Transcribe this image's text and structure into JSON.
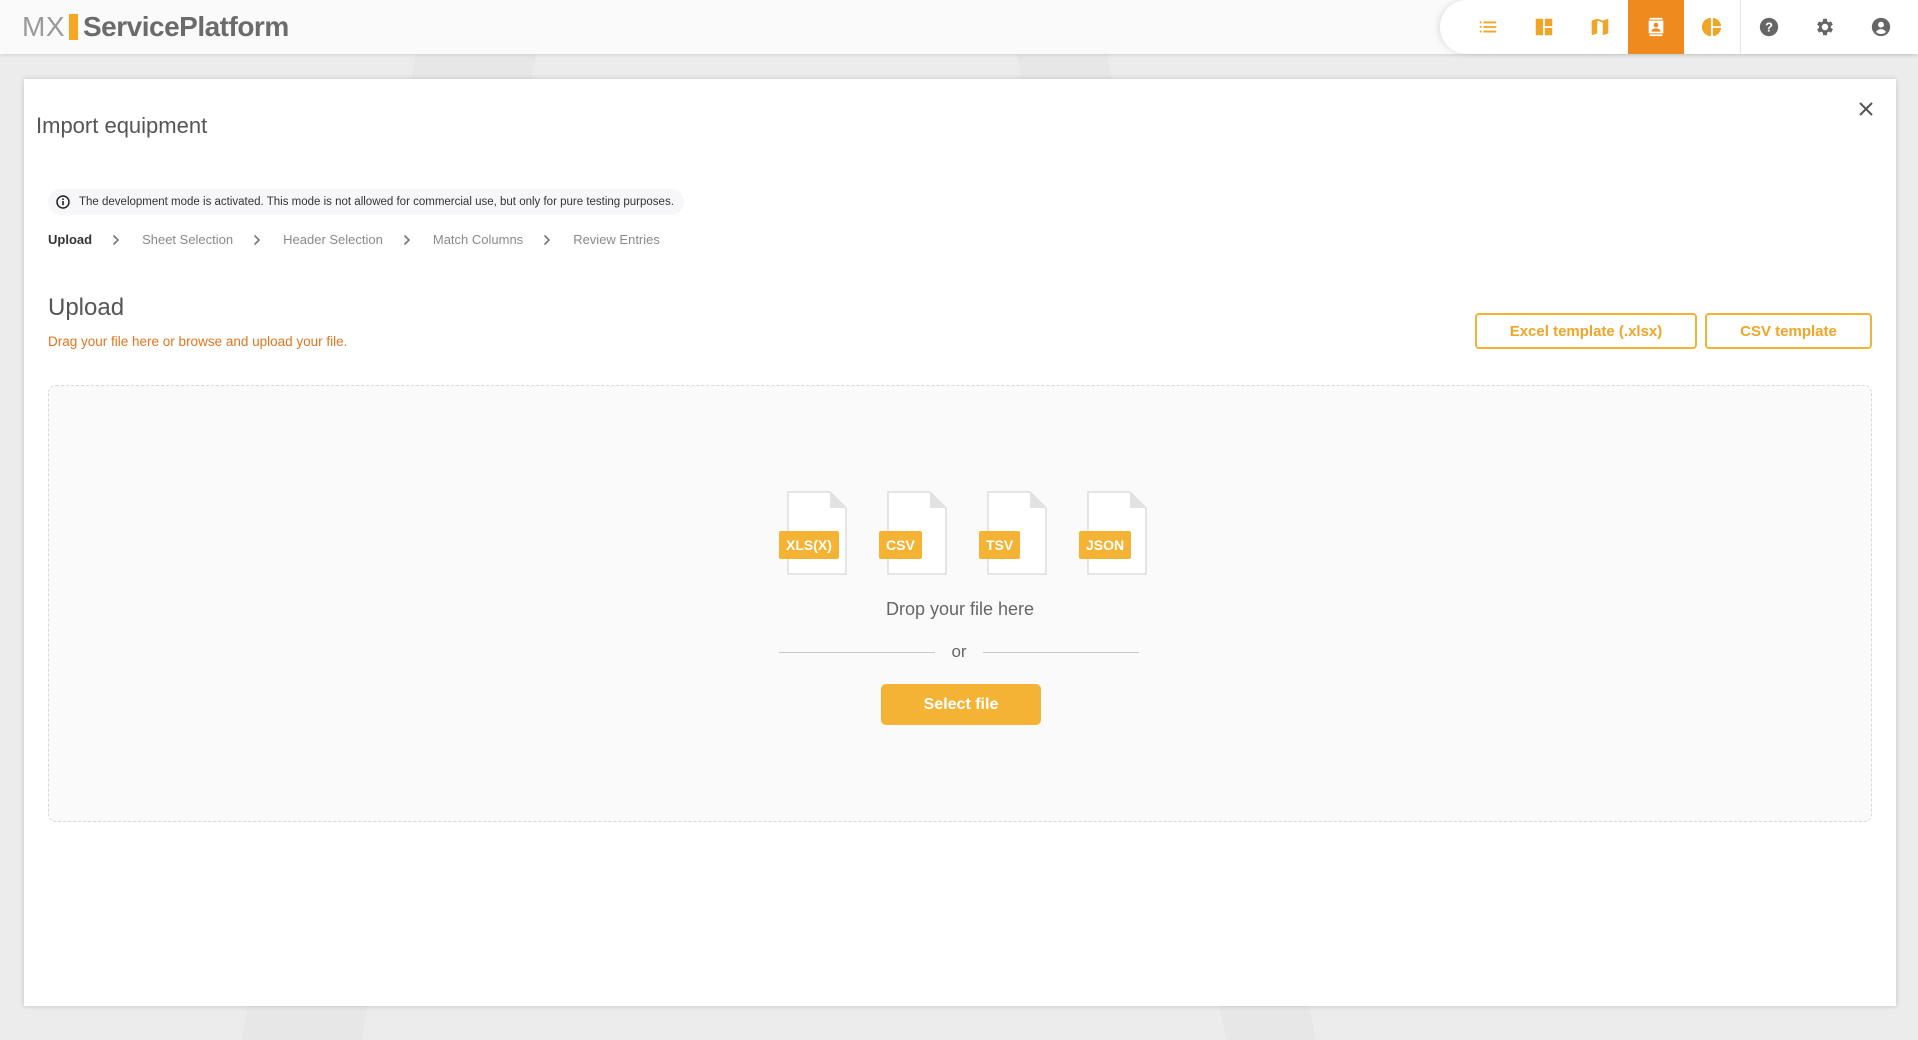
{
  "app": {
    "logo_prefix": "MX",
    "logo_name": "ServicePlatform"
  },
  "topnav": {
    "items": [
      {
        "name": "list-icon",
        "active": false
      },
      {
        "name": "dashboard-icon",
        "active": false
      },
      {
        "name": "map-icon",
        "active": false
      },
      {
        "name": "contacts-icon",
        "active": true
      },
      {
        "name": "pie-chart-icon",
        "active": false
      },
      {
        "name": "help-icon",
        "active": false
      },
      {
        "name": "settings-icon",
        "active": false
      },
      {
        "name": "account-icon",
        "active": false
      }
    ]
  },
  "dialog": {
    "title": "Import equipment",
    "notice": "The development mode is activated. This mode is not allowed for commercial use, but only for pure testing purposes.",
    "steps": [
      "Upload",
      "Sheet Selection",
      "Header Selection",
      "Match Columns",
      "Review Entries"
    ],
    "current_step": "Upload",
    "upload_heading": "Upload",
    "upload_subtitle": "Drag your file here or browse and upload your file.",
    "excel_template_label": "Excel template (.xlsx)",
    "csv_template_label": "CSV template",
    "file_types": [
      "XLS(X)",
      "CSV",
      "TSV",
      "JSON"
    ],
    "drop_text": "Drop your file here",
    "or_text": "or",
    "select_file_label": "Select file"
  },
  "colors": {
    "accent": "#f5b335",
    "active_nav": "#ef8a1f",
    "subtitle": "#e4751e"
  }
}
